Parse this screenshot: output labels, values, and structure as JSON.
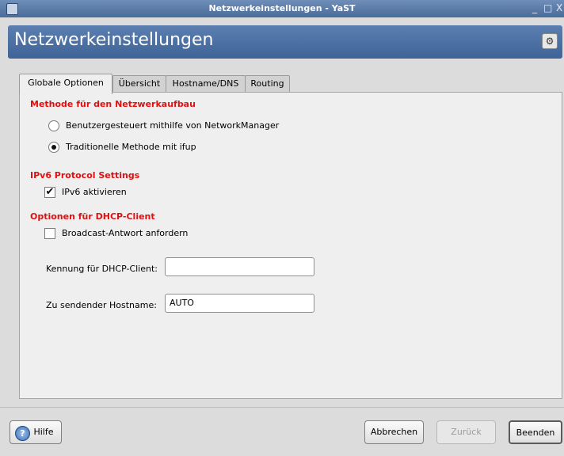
{
  "window": {
    "title": "Netzwerkeinstellungen - YaST",
    "controls": [
      "_",
      "□",
      "X"
    ]
  },
  "header": {
    "title": "Netzwerkeinstellungen",
    "icon": "network-settings-icon"
  },
  "tabs": [
    {
      "label": "Globale Optionen",
      "active": true
    },
    {
      "label": "Übersicht",
      "active": false
    },
    {
      "label": "Hostname/DNS",
      "active": false
    },
    {
      "label": "Routing",
      "active": false
    }
  ],
  "network_method": {
    "heading": "Methode für den Netzwerkaufbau",
    "options": [
      {
        "label": "Benutzergesteuert mithilfe von NetworkManager",
        "selected": false
      },
      {
        "label": "Traditionelle Methode mit ifup",
        "selected": true
      }
    ]
  },
  "ipv6": {
    "heading": "IPv6 Protocol Settings",
    "checkbox_label": "IPv6 aktivieren",
    "checked": true
  },
  "dhcp": {
    "heading": "Optionen für DHCP-Client",
    "broadcast_label": "Broadcast-Antwort anfordern",
    "broadcast_checked": false,
    "client_id_label": "Kennung für DHCP-Client:",
    "client_id_value": "",
    "hostname_label": "Zu sendender Hostname:",
    "hostname_value": "AUTO"
  },
  "buttons": {
    "help": "Hilfe",
    "cancel": "Abbrechen",
    "back": "Zurück",
    "finish": "Beenden"
  }
}
